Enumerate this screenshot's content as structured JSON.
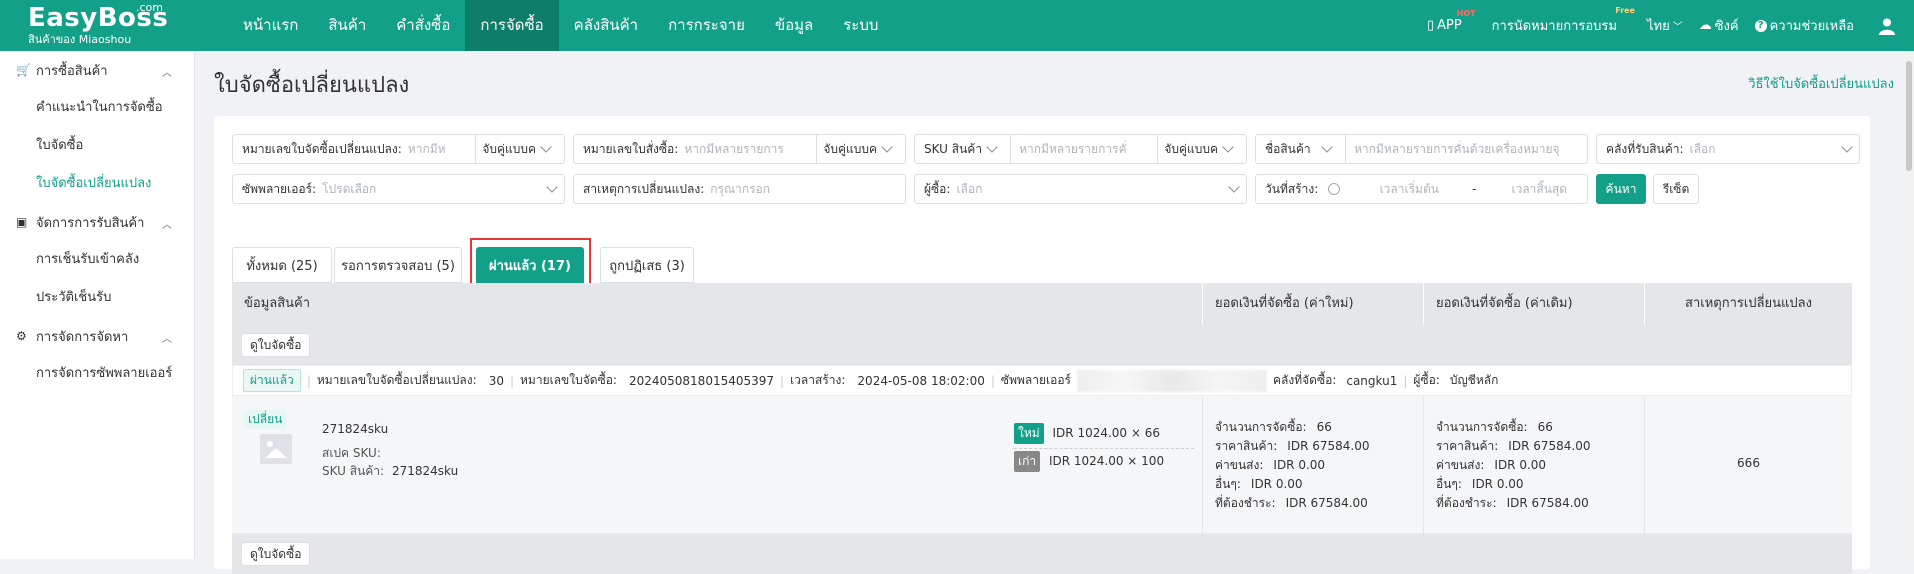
{
  "brand": {
    "name": "EasyBoss",
    "com": ".com",
    "sub": "สินค้าของ Miaoshou"
  },
  "nav": [
    {
      "label": "หน้าแรก",
      "active": false
    },
    {
      "label": "สินค้า",
      "active": false
    },
    {
      "label": "คำสั่งซื้อ",
      "active": false
    },
    {
      "label": "การจัดซื้อ",
      "active": true
    },
    {
      "label": "คลังสินค้า",
      "active": false
    },
    {
      "label": "การกระจาย",
      "active": false
    },
    {
      "label": "ข้อมูล",
      "active": false
    },
    {
      "label": "ระบบ",
      "active": false
    }
  ],
  "topright": {
    "app": "APP",
    "hot": "HOT",
    "training": "การนัดหมายการอบรม",
    "free": "Free",
    "lang": "ไทย",
    "sync": "ซิงค์",
    "help": "ความช่วยเหลือ"
  },
  "sidebar": {
    "groups": [
      {
        "label": "การซื้อสินค้า",
        "icon": "cart-icon",
        "items": [
          {
            "label": "คำแนะนำในการจัดซื้อ",
            "active": false
          },
          {
            "label": "ใบจัดซื้อ",
            "active": false
          },
          {
            "label": "ใบจัดซื้อเปลี่ยนแปลง",
            "active": true
          }
        ]
      },
      {
        "label": "จัดการการรับสินค้า",
        "icon": "clipboard-icon",
        "items": [
          {
            "label": "การเช็นรับเข้าคลัง",
            "active": false
          },
          {
            "label": "ประวัติเช็นรับ",
            "active": false
          }
        ]
      },
      {
        "label": "การจัดการจัดหา",
        "icon": "user-gear-icon",
        "items": [
          {
            "label": "การจัดการซัพพลายเออร์",
            "active": false
          }
        ]
      }
    ]
  },
  "page": {
    "title": "ใบจัดซื้อเปลี่ยนแปลง",
    "help_link": "วิธีใช้ใบจัดซื้อเปลี่ยนแปลง"
  },
  "filters": {
    "change_no": {
      "label": "หมายเลขใบจัดซื้อเปลี่ยนแปลง:",
      "placeholder": "หากมีห",
      "match": "จับคู่แบบค"
    },
    "order_no": {
      "label": "หมายเลขใบสั่งซื้อ:",
      "placeholder": "หากมีหลายรายการ",
      "match": "จับคู่แบบค"
    },
    "sku": {
      "type": "SKU สินค้า",
      "placeholder": "หากมีหลายรายการคั่",
      "match": "จับคู่แบบค"
    },
    "product_name": {
      "type": "ชื่อสินค้า",
      "placeholder": "หากมีหลายรายการคั่นด้วยเครื่องหมายจุ"
    },
    "warehouse": {
      "label": "คลังที่รับสินค้า:",
      "placeholder": "เลือก"
    },
    "supplier": {
      "label": "ซัพพลายเออร์:",
      "placeholder": "โปรดเลือก"
    },
    "reason": {
      "label": "สาเหตุการเปลี่ยนแปลง:",
      "placeholder": "กรุณากรอก"
    },
    "buyer": {
      "label": "ผู้ซื้อ:",
      "placeholder": "เลือก"
    },
    "created": {
      "label": "วันที่สร้าง:",
      "start": "เวลาเริ่มต้น",
      "dash": "-",
      "end": "เวลาสิ้นสุด"
    },
    "search_btn": "ค้นหา",
    "reset_btn": "รีเซ็ต"
  },
  "tabs": [
    {
      "label": "ทั้งหมด (25)",
      "active": false
    },
    {
      "label": "รอการตรวจสอบ (5)",
      "active": false
    },
    {
      "label": "ผ่านแล้ว (17)",
      "active": true
    },
    {
      "label": "ถูกปฏิเสธ (3)",
      "active": false
    }
  ],
  "table": {
    "headers": [
      "ข้อมูลสินค้า",
      "ยอดเงินที่จัดซื้อ (ค่าใหม่)",
      "ยอดเงินที่จัดซื้อ (ค่าเดิม)",
      "สาเหตุการเปลี่ยนแปลง"
    ],
    "view_po_btn": "ดูใบจัดซื้อ",
    "record": {
      "status": "ผ่านแล้ว",
      "change_no_label": "หมายเลขใบจัดซื้อเปลี่ยนแปลง:",
      "change_no": "30",
      "po_no_label": "หมายเลขใบจัดซื้อ:",
      "po_no": "2024050818015405397",
      "created_label": "เวลาสร้าง:",
      "created": "2024-05-08 18:02:00",
      "supplier_label": "ซัพพลายเออร์",
      "warehouse_label": "คลังที่จัดซื้อ:",
      "warehouse": "cangku1",
      "buyer_label": "ผู้ซื้อ:",
      "buyer": "บัญชีหลัก",
      "item": {
        "change_tag": "เปลี่ยน",
        "name": "271824sku",
        "spec_label": "สเปค SKU:",
        "spec": "",
        "sku_label": "SKU สินค้า:",
        "sku": "271824sku",
        "new_tag": "ใหม่",
        "new_price": "IDR 1024.00 × 66",
        "old_tag": "เก่า",
        "old_price": "IDR 1024.00 × 100",
        "amount_new": [
          {
            "label": "จำนวนการจัดซื้อ:",
            "value": "66"
          },
          {
            "label": "ราคาสินค้า:",
            "value": "IDR 67584.00"
          },
          {
            "label": "ค่าขนส่ง:",
            "value": "IDR 0.00"
          },
          {
            "label": "อื่นๆ:",
            "value": "IDR 0.00"
          },
          {
            "label": "ที่ต้องชำระ:",
            "value": "IDR 67584.00"
          }
        ],
        "amount_old": [
          {
            "label": "จำนวนการจัดซื้อ:",
            "value": "66"
          },
          {
            "label": "ราคาสินค้า:",
            "value": "IDR 67584.00"
          },
          {
            "label": "ค่าขนส่ง:",
            "value": "IDR 0.00"
          },
          {
            "label": "อื่นๆ:",
            "value": "IDR 0.00"
          },
          {
            "label": "ที่ต้องชำระ:",
            "value": "IDR 67584.00"
          }
        ],
        "reason": "666"
      }
    }
  },
  "colors": {
    "brand": "#13a088",
    "nav_active": "#0e7d6a",
    "highlight": "#e53935",
    "new_tag": "#13a088",
    "old_tag": "#888888"
  }
}
